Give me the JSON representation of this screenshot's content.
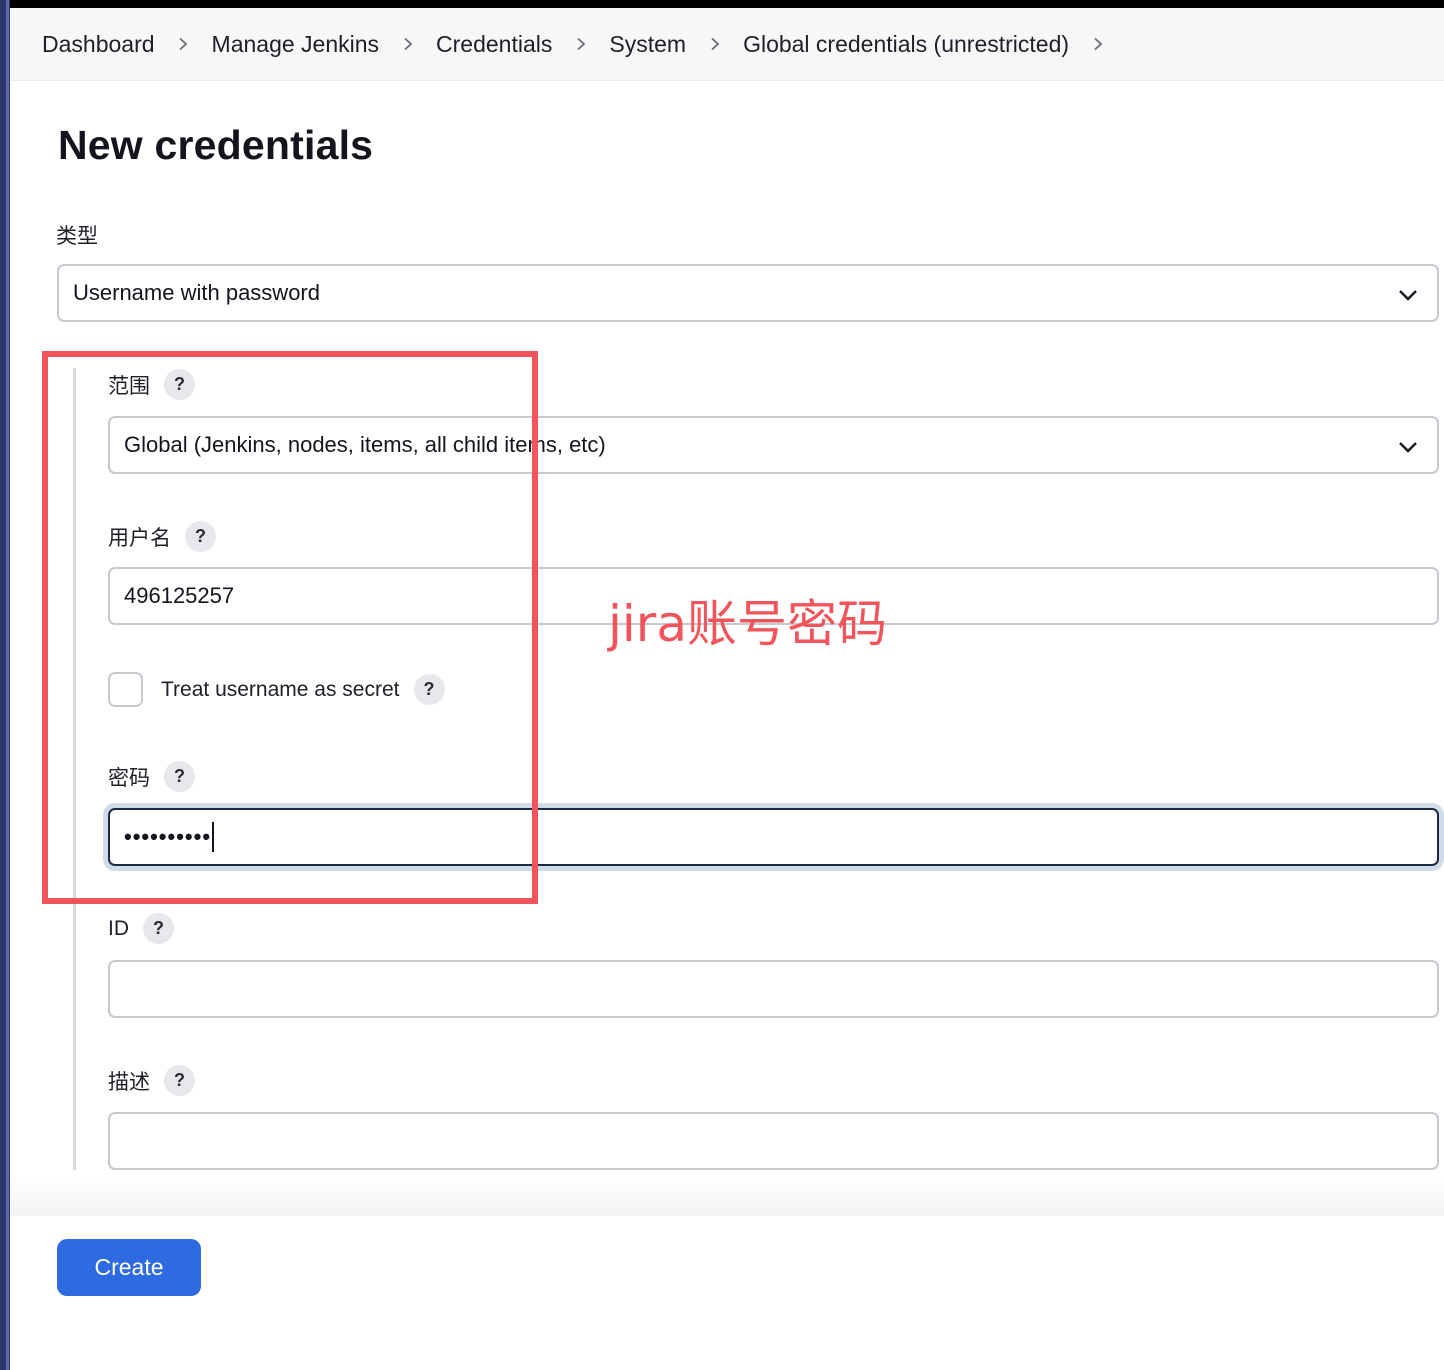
{
  "breadcrumb": {
    "items": [
      "Dashboard",
      "Manage Jenkins",
      "Credentials",
      "System",
      "Global credentials (unrestricted)"
    ]
  },
  "page": {
    "title": "New credentials"
  },
  "form": {
    "kind": {
      "label": "类型",
      "value": "Username with password"
    },
    "scope": {
      "label": "范围",
      "value": "Global (Jenkins, nodes, items, all child items, etc)"
    },
    "username": {
      "label": "用户名",
      "value": "496125257"
    },
    "username_secret": {
      "label": "Treat username as secret",
      "checked": false
    },
    "password": {
      "label": "密码",
      "masked_value": "••••••••••"
    },
    "id": {
      "label": "ID",
      "value": ""
    },
    "description": {
      "label": "描述",
      "value": ""
    },
    "help_glyph": "?"
  },
  "annotation": {
    "text": "jira账号密码",
    "color": "#f2545b"
  },
  "actions": {
    "create_label": "Create"
  },
  "colors": {
    "primary": "#2f6be0",
    "annotation": "#f2545b",
    "focus_ring": "#cfdbe9"
  },
  "icons": {
    "separator": "chevron-right-icon",
    "select": "chevron-down-icon",
    "help": "help-icon"
  }
}
